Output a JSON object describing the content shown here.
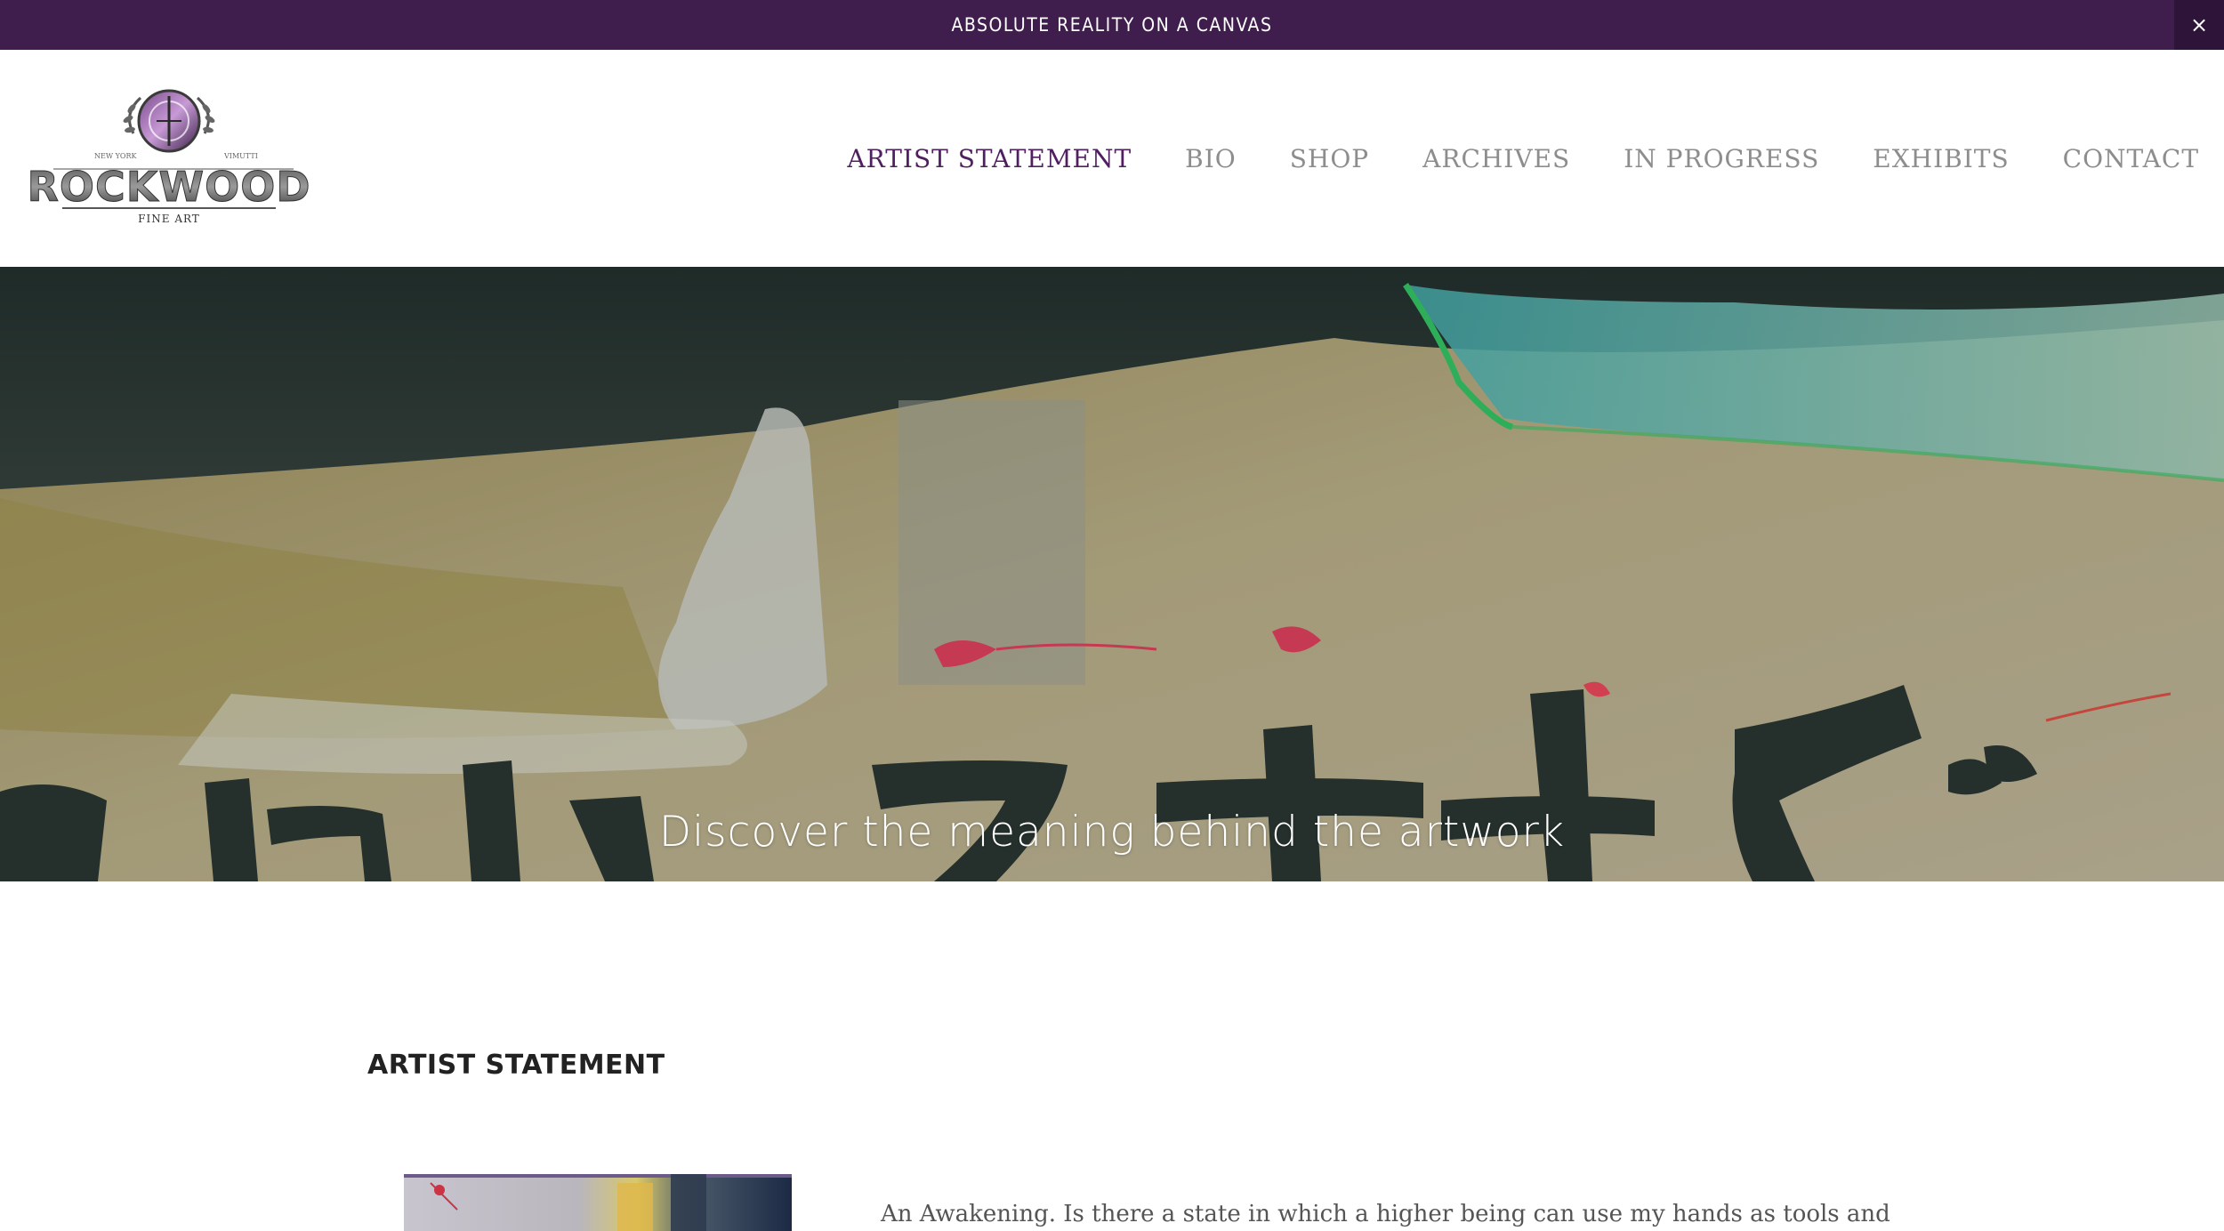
{
  "announcement": {
    "text": "ABSOLUTE REALITY ON A CANVAS",
    "close_icon": "close-icon",
    "close_glyph": "×"
  },
  "logo": {
    "name": "ROCKWOOD",
    "subtitle": "FINE ART",
    "left_label": "NEW YORK",
    "right_label": "VIMUTTI"
  },
  "nav": {
    "items": [
      {
        "label": "ARTIST STATEMENT",
        "active": true
      },
      {
        "label": "BIO"
      },
      {
        "label": "SHOP"
      },
      {
        "label": "ARCHIVES"
      },
      {
        "label": "IN PROGRESS"
      },
      {
        "label": "EXHIBITS"
      },
      {
        "label": "CONTACT"
      }
    ]
  },
  "hero": {
    "tagline": "Discover the meaning behind the artwork"
  },
  "main": {
    "section_title": "ARTIST STATEMENT",
    "intro_text": "An Awakening. Is there a state in which a higher being can use my hands as tools and"
  },
  "colors": {
    "accent": "#3f1d4d",
    "nav_active": "#4f1f5f",
    "nav_default": "#8d8d8d"
  }
}
